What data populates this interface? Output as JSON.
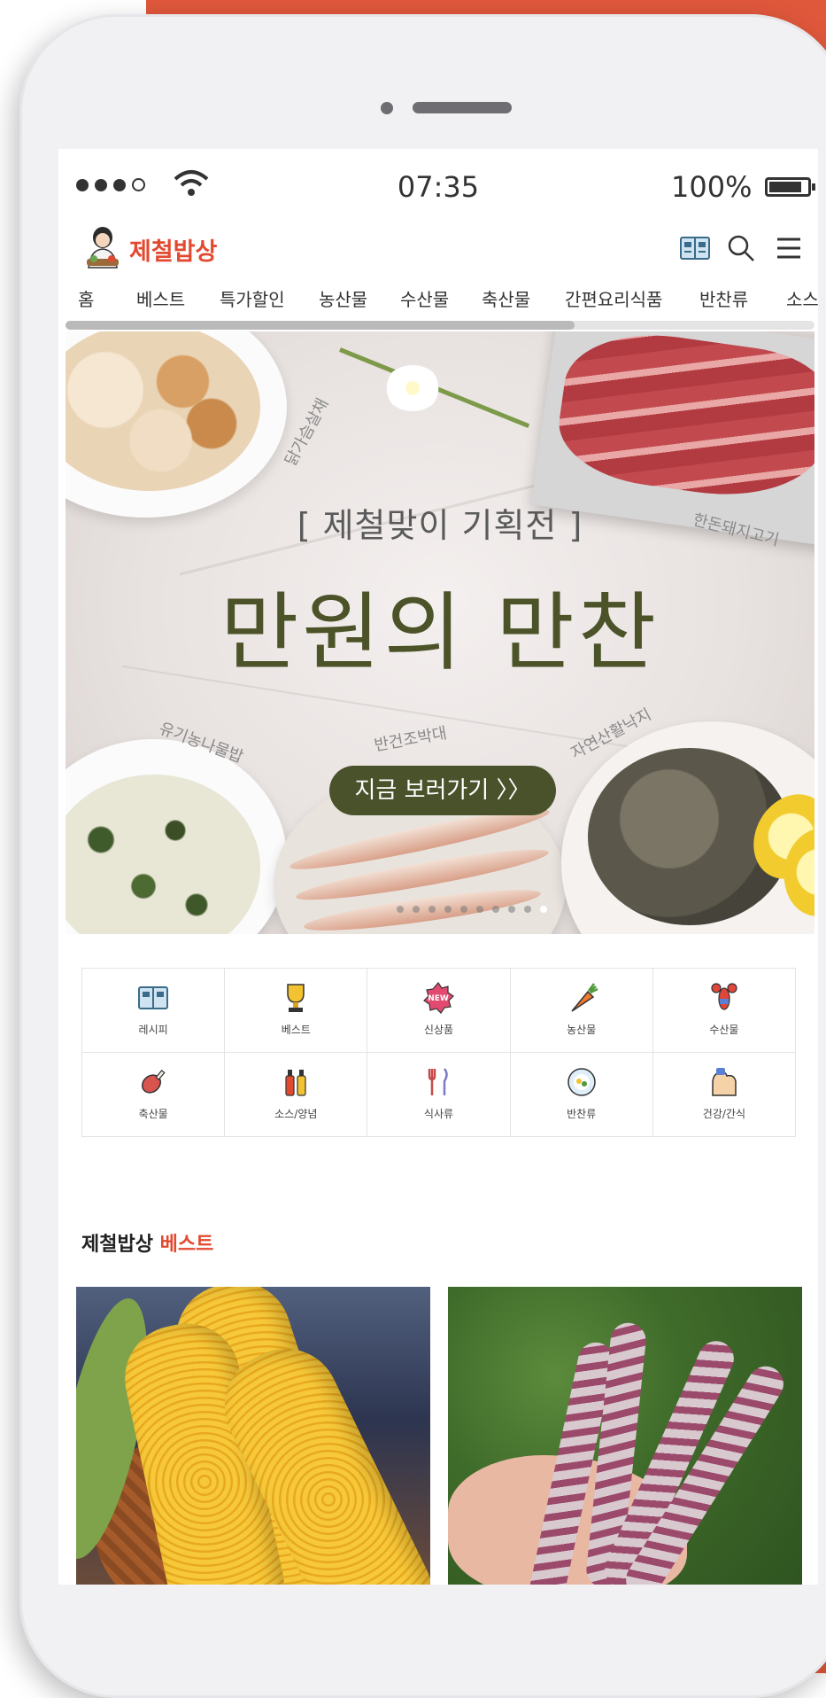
{
  "status": {
    "time": "07:35",
    "battery_pct": "100%",
    "battery_level": 0.85
  },
  "header": {
    "brand": "제철밥상",
    "icons": [
      "recipe-book-icon",
      "search-icon",
      "menu-icon"
    ]
  },
  "nav": {
    "items": [
      "홈",
      "베스트",
      "특가할인",
      "농산물",
      "수산물",
      "축산물",
      "간편요리식품",
      "반찬류",
      "소스"
    ],
    "scroll_fraction": 0.68
  },
  "banner": {
    "subtitle": "[ 제철맞이 기획전 ]",
    "title": "만원의 만찬",
    "cta": "지금 보러가기  〉〉",
    "tags": [
      "닭가슴살채",
      "한돈돼지고기",
      "유기농나물밥",
      "반건조박대",
      "자연산활낙지"
    ],
    "slide_count": 10,
    "active_slide": 10
  },
  "categories": [
    {
      "label": "레시피",
      "icon": "recipe-book-icon"
    },
    {
      "label": "베스트",
      "icon": "trophy-icon"
    },
    {
      "label": "신상품",
      "icon": "new-badge-icon"
    },
    {
      "label": "농산물",
      "icon": "carrot-icon"
    },
    {
      "label": "수산물",
      "icon": "lobster-icon"
    },
    {
      "label": "축산물",
      "icon": "meat-icon"
    },
    {
      "label": "소스/양념",
      "icon": "sauce-bottles-icon"
    },
    {
      "label": "식사류",
      "icon": "utensils-icon"
    },
    {
      "label": "반찬류",
      "icon": "plate-icon"
    },
    {
      "label": "건강/간식",
      "icon": "muscle-icon"
    }
  ],
  "best": {
    "title_prefix": "제철밥상",
    "title_accent": "베스트",
    "products": [
      {
        "image": "corn-photo"
      },
      {
        "image": "bean-pods-photo"
      }
    ]
  },
  "colors": {
    "accent": "#e0583c",
    "brand_red": "#e24a30",
    "banner_olive": "#4c5329"
  }
}
